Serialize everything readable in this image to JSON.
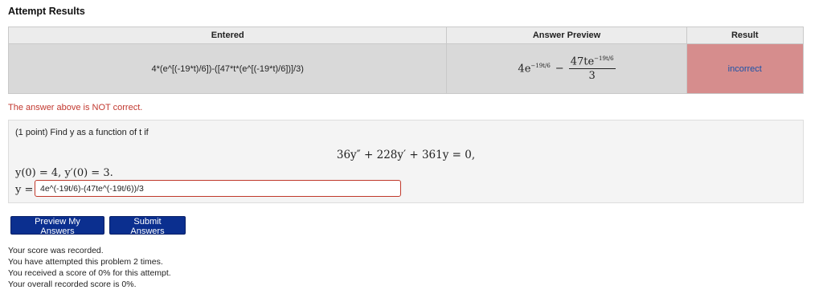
{
  "heading": "Attempt Results",
  "table": {
    "headers": {
      "entered": "Entered",
      "preview": "Answer Preview",
      "result": "Result"
    },
    "entered": "4*(e^[(-19*t)/6])-([47*t*(e^[(-19*t)/6])]/3)",
    "preview": {
      "term1_coef": "4e",
      "term1_exp": "−19t/6",
      "minus": "−",
      "frac_num": "47te",
      "frac_num_exp": "−19t/6",
      "frac_den": "3"
    },
    "result": "incorrect"
  },
  "status_message": "The answer above is NOT correct.",
  "problem": {
    "intro": "(1 point) Find y as a function of t if",
    "equation": "36y″ + 228y′ + 361y = 0,",
    "initial_conditions": "y(0) = 4,   y′(0) = 3.",
    "answer_label": "y =",
    "answer_value": "4e^(-19t/6)-(47te^(-19t/6))/3"
  },
  "buttons": {
    "preview": "Preview My Answers",
    "submit": "Submit Answers"
  },
  "score_lines": [
    "Your score was recorded.",
    "You have attempted this problem 2 times.",
    "You received a score of 0% for this attempt.",
    "Your overall recorded score is 0%."
  ]
}
